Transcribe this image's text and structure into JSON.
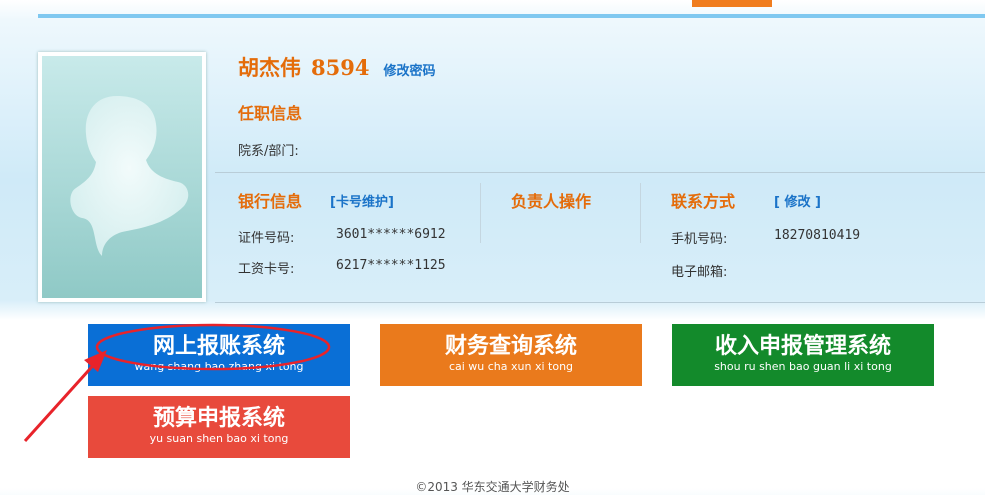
{
  "profile": {
    "name": "胡杰伟",
    "id": "8594",
    "change_password": "修改密码"
  },
  "employment": {
    "title": "任职信息",
    "department_label": "院系/部门:"
  },
  "bank": {
    "title": "银行信息",
    "card_maintain": "[卡号维护]",
    "id_label": "证件号码:",
    "id_value": "3601******6912",
    "salary_label": "工资卡号:",
    "salary_value": "6217******1125"
  },
  "manager": {
    "title": "负责人操作"
  },
  "contact": {
    "title": "联系方式",
    "edit": "[ 修改 ]",
    "phone_label": "手机号码:",
    "phone_value": "18270810419",
    "email_label": "电子邮箱:"
  },
  "systems": [
    {
      "title": "网上报账系统",
      "pinyin": "wang shang bao zhang xi tong",
      "color": "#0a6fd6"
    },
    {
      "title": "财务查询系统",
      "pinyin": "cai wu cha xun xi tong",
      "color": "#ea7a1c"
    },
    {
      "title": "收入申报管理系统",
      "pinyin": "shou ru shen bao guan li xi tong",
      "color": "#138a2b"
    },
    {
      "title": "预算申报系统",
      "pinyin": "yu suan shen bao xi tong",
      "color": "#e84a3c"
    }
  ],
  "footer": "©2013 华东交通大学财务处"
}
